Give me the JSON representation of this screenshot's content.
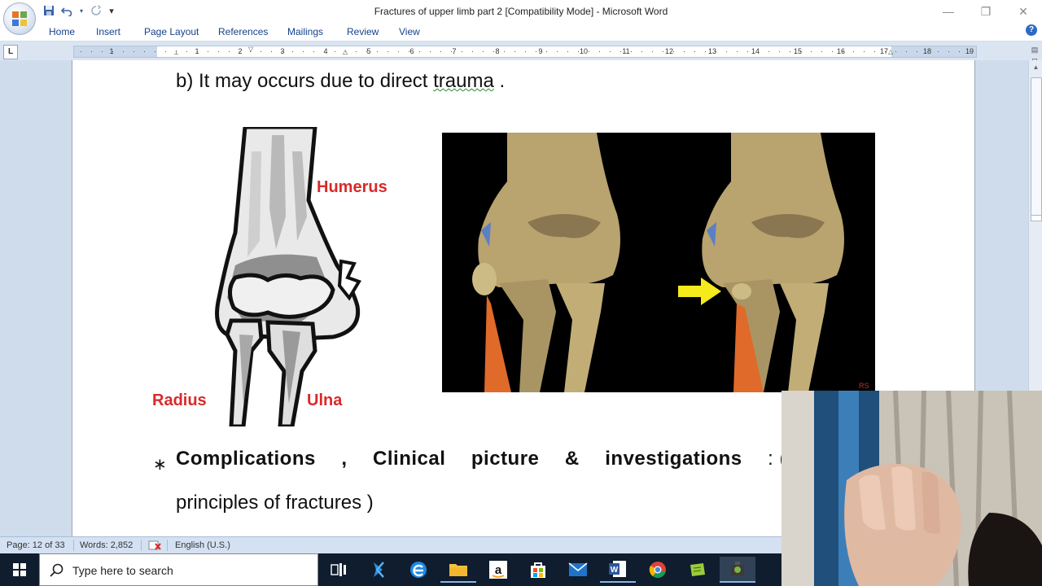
{
  "window": {
    "title": "Fractures of upper limb part 2 [Compatibility Mode] - Microsoft Word",
    "minimize_glyph": "—",
    "restore_glyph": "❐",
    "close_glyph": "✕"
  },
  "quick_access": {
    "save_icon": "save-icon",
    "undo_icon": "undo-icon",
    "redo_icon": "redo-icon",
    "customize_glyph": "▾"
  },
  "ribbon": {
    "tabs": [
      "Home",
      "Insert",
      "Page Layout",
      "References",
      "Mailings",
      "Review",
      "View"
    ],
    "help_glyph": "?"
  },
  "ruler": {
    "tab_selector": "L",
    "left_numbers": [
      "1",
      "1",
      "2"
    ],
    "numbers": [
      "1",
      "2",
      "3",
      "4",
      "5",
      "6",
      "7",
      "8",
      "9",
      "10",
      "11",
      "12",
      "13",
      "14",
      "15",
      "16",
      "17",
      "18",
      "19"
    ]
  },
  "document": {
    "line1_prefix": "b)  It may occurs due to direct ",
    "line1_underlined": "trauma",
    "line1_suffix": " .",
    "bullet": "∗",
    "complications_words": [
      "Complications",
      ",",
      "Clinical",
      "picture",
      "&",
      "investigations"
    ],
    "complications_tail": ":  (",
    "line3": "principles of fractures )",
    "diagram_labels": {
      "humerus": "Humerus",
      "radius": "Radius",
      "ulna": "Ulna"
    },
    "photo_signature": "RS"
  },
  "status_bar": {
    "page": "Page: 12 of 33",
    "words": "Words: 2,852",
    "language": "English (U.S.)"
  },
  "taskbar": {
    "search_placeholder": "Type here to search",
    "apps": [
      "task-view",
      "visual-studio",
      "edge",
      "file-explorer",
      "amazon",
      "store",
      "mail",
      "word",
      "chrome",
      "green-app",
      "media-app"
    ]
  }
}
